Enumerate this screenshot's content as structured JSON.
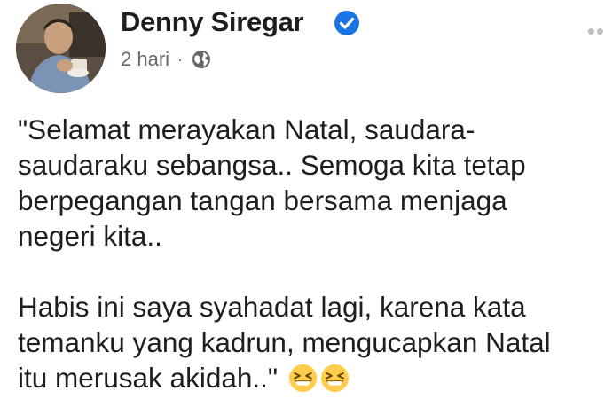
{
  "post": {
    "author": "Denny Siregar",
    "timestamp": "2 hari",
    "separator": "·",
    "audience_icon": "globe-icon",
    "verified_icon": "verified-badge-icon",
    "more_label": "••",
    "paragraphs": [
      "\"Selamat merayakan Natal, saudara-\nsaudaraku sebangsa.. Semoga kita tetap\nberpegangan tangan bersama menjaga\nnegeri kita..",
      "Habis ini saya syahadat lagi, karena kata\ntemanku yang kadrun, mengucapkan Natal\nitu merusak akidah..\""
    ],
    "emojis": [
      "grinning-squinting-face-emoji",
      "grinning-squinting-face-emoji"
    ]
  },
  "colors": {
    "verified_blue": "#1b74e4",
    "meta_gray": "#65676b",
    "text": "#1c1e21"
  }
}
